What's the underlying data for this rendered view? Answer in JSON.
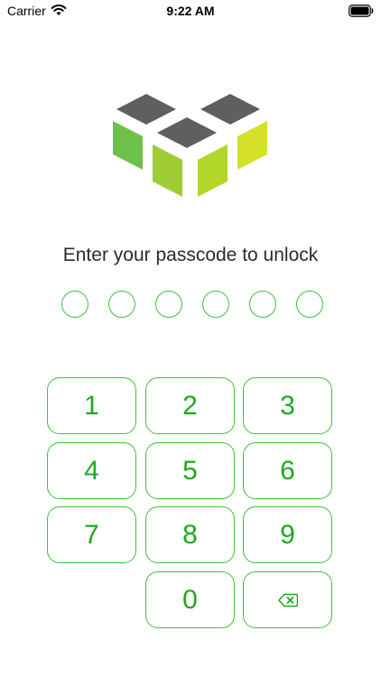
{
  "status_bar": {
    "carrier": "Carrier",
    "time": "9:22 AM",
    "wifi_icon": "wifi-icon",
    "battery_icon": "battery-icon"
  },
  "logo": {
    "icon": "cube-logo-icon",
    "colors": {
      "top_faces": "#5f5f5f",
      "left_green": "#6fc04a",
      "mid_green": "#a8d42b",
      "right_yellow": "#d4e02a"
    }
  },
  "prompt": "Enter your passcode to unlock",
  "passcode": {
    "length": 6,
    "entered": 0
  },
  "keypad": {
    "keys": [
      "1",
      "2",
      "3",
      "4",
      "5",
      "6",
      "7",
      "8",
      "9",
      "",
      "0",
      "backspace"
    ],
    "key_labels": {
      "k1": "1",
      "k2": "2",
      "k3": "3",
      "k4": "4",
      "k5": "5",
      "k6": "6",
      "k7": "7",
      "k8": "8",
      "k9": "9",
      "k0": "0"
    },
    "backspace_icon": "backspace-icon",
    "accent_color": "#3cc23c",
    "digit_color": "#1fa81f"
  }
}
